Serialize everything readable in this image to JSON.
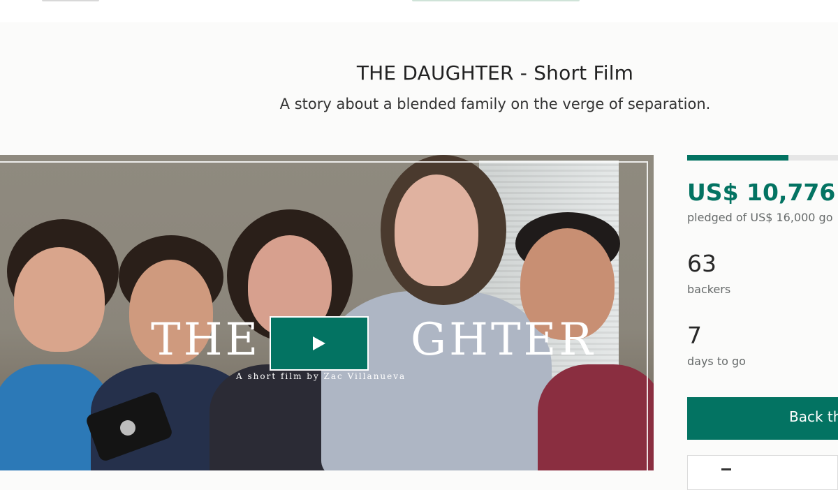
{
  "project": {
    "title": "THE DAUGHTER - Short Film",
    "blurb": "A story about a blended family on the verge of separation."
  },
  "video": {
    "overlay_title_left": "THE",
    "overlay_title_right": "GHTER",
    "overlay_credit": "A short film by Zac Villanueva"
  },
  "stats": {
    "progress_fraction": 0.6735,
    "pledged": "US$ 10,776",
    "pledged_of": "pledged of US$ 16,000 go",
    "backers_count": "63",
    "backers_label": "backers",
    "days_count": "7",
    "days_label": "days to go"
  },
  "actions": {
    "back_button_label": "Back th"
  },
  "colors": {
    "accent": "#037362",
    "text_dark": "#282828",
    "text_muted": "#656969"
  }
}
